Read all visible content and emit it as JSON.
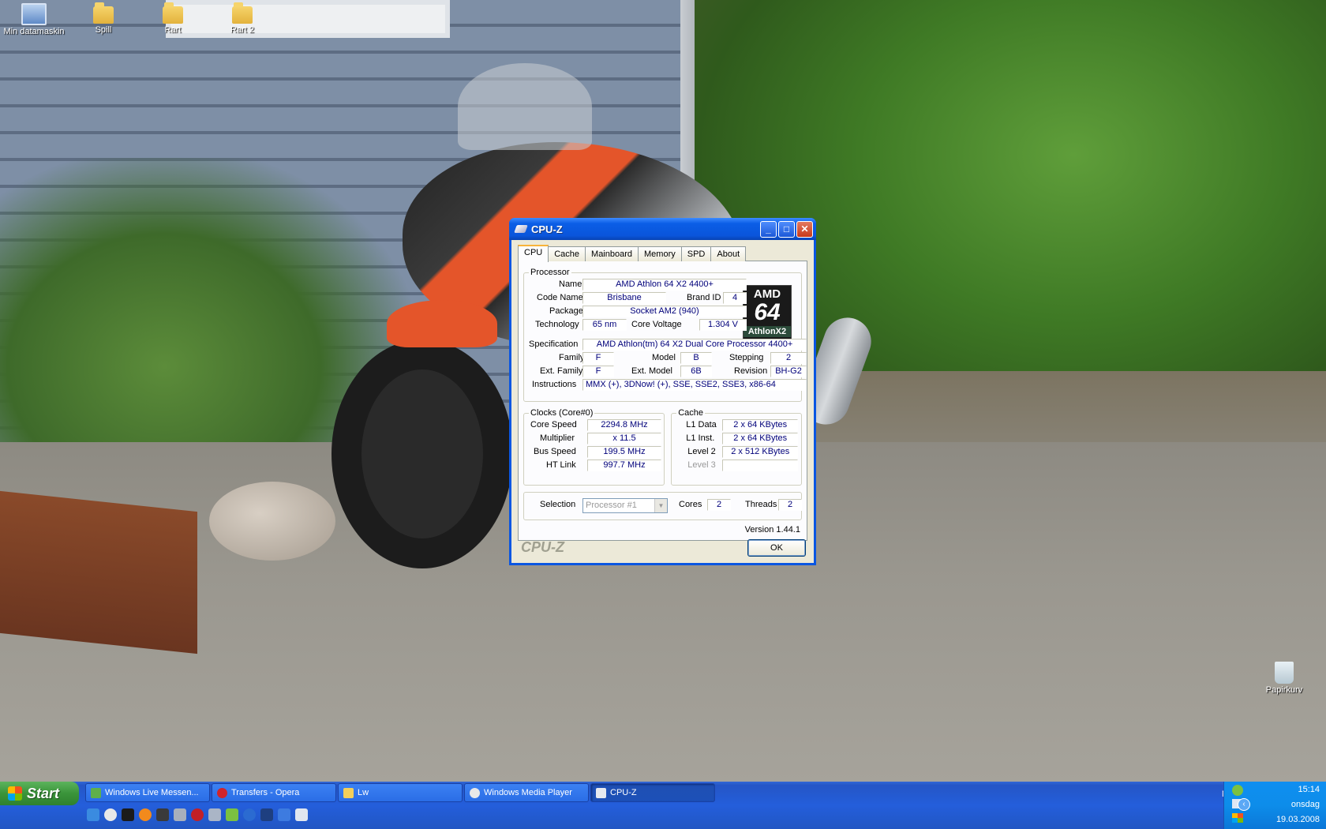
{
  "desktop": {
    "icons": [
      {
        "label": "Min datamaskin",
        "icon": "my-computer-icon"
      },
      {
        "label": "Spill",
        "icon": "folder-icon"
      },
      {
        "label": "Rart",
        "icon": "folder-icon"
      },
      {
        "label": "Rart 2",
        "icon": "folder-icon"
      },
      {
        "label": "Papirkurv",
        "icon": "recycle-bin-icon"
      }
    ]
  },
  "window": {
    "title": "CPU-Z",
    "tabs": [
      "CPU",
      "Cache",
      "Mainboard",
      "Memory",
      "SPD",
      "About"
    ],
    "active_tab": "CPU",
    "processor": {
      "legend": "Processor",
      "name_label": "Name",
      "name": "AMD Athlon 64 X2 4400+",
      "codename_label": "Code Name",
      "codename": "Brisbane",
      "brandid_label": "Brand ID",
      "brandid": "4",
      "package_label": "Package",
      "package": "Socket AM2 (940)",
      "technology_label": "Technology",
      "technology": "65 nm",
      "voltage_label": "Core Voltage",
      "voltage": "1.304 V",
      "spec_label": "Specification",
      "spec": "AMD Athlon(tm) 64 X2 Dual Core Processor 4400+",
      "family_label": "Family",
      "family": "F",
      "model_label": "Model",
      "model": "B",
      "stepping_label": "Stepping",
      "stepping": "2",
      "extfamily_label": "Ext. Family",
      "extfamily": "F",
      "extmodel_label": "Ext. Model",
      "extmodel": "6B",
      "revision_label": "Revision",
      "revision": "BH-G2",
      "instructions_label": "Instructions",
      "instructions": "MMX (+), 3DNow! (+), SSE, SSE2, SSE3, x86-64",
      "logo": {
        "brand": "AMD",
        "big": "64",
        "sub": "AthlonX2"
      }
    },
    "clocks": {
      "legend": "Clocks (Core#0)",
      "corespeed_label": "Core Speed",
      "corespeed": "2294.8 MHz",
      "multiplier_label": "Multiplier",
      "multiplier": "x 11.5",
      "busspeed_label": "Bus Speed",
      "busspeed": "199.5 MHz",
      "htlink_label": "HT Link",
      "htlink": "997.7 MHz"
    },
    "cache": {
      "legend": "Cache",
      "l1data_label": "L1 Data",
      "l1data": "2 x 64 KBytes",
      "l1inst_label": "L1 Inst.",
      "l1inst": "2 x 64 KBytes",
      "level2_label": "Level 2",
      "level2": "2 x 512 KBytes",
      "level3_label": "Level 3",
      "level3": ""
    },
    "selection": {
      "label": "Selection",
      "value": "Processor #1",
      "cores_label": "Cores",
      "cores": "2",
      "threads_label": "Threads",
      "threads": "2"
    },
    "version": "Version 1.44.1",
    "brand": "CPU-Z",
    "ok_label": "OK"
  },
  "taskbar": {
    "start_label": "Start",
    "tasks": [
      {
        "label": "Windows Live Messen...",
        "icon": "messenger-icon"
      },
      {
        "label": "Transfers - Opera",
        "icon": "opera-icon"
      },
      {
        "label": "Lw",
        "icon": "folder-icon"
      },
      {
        "label": "Windows Media Player",
        "icon": "media-player-icon"
      },
      {
        "label": "CPU-Z",
        "icon": "cpuz-icon"
      }
    ],
    "tray": {
      "lang": "NC",
      "time": "15:14",
      "day": "onsdag",
      "date": "19.03.2008"
    }
  }
}
